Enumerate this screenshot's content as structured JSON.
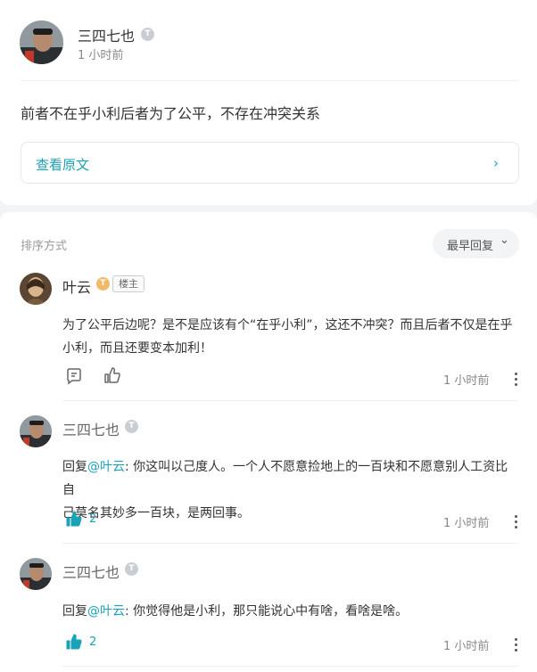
{
  "post": {
    "author": "三四七也",
    "time": "1 小时前",
    "content": "前者不在乎小利后者为了公平，不存在冲突关系",
    "view_original": "查看原文",
    "chevron": "›"
  },
  "comments_header": {
    "sort_label": "排序方式",
    "sort_value": "最早回复",
    "sort_caret": "⌄"
  },
  "comments": [
    {
      "author": "叶云",
      "tag": "楼主",
      "line1": "为了公平后边呢？是不是应该有个“在乎小利”，这还不冲突？而且后者不仅是在乎",
      "line2": "小利，而且还要变本加利！",
      "time": "1 小时前"
    },
    {
      "author": "三四七也",
      "reply_prefix": "回复",
      "mention": "@叶云",
      "text_line1": ": 你这叫以己度人。一个人不愿意捡地上的一百块和不愿意别人工资比自",
      "text_line2": "己莫名其妙多一百块，是两回事。",
      "likes": "2",
      "time": "1 小时前"
    },
    {
      "author": "三四七也",
      "reply_prefix": "回复",
      "mention": "@叶云",
      "text_line1": ": 你觉得他是小利，那只能说心中有啥，看啥是啥。",
      "likes": "2",
      "time": "1 小时前"
    }
  ],
  "badge_letter": "T",
  "colors": {
    "accent": "#1aa2b8",
    "bg": "#f3f4f6"
  }
}
